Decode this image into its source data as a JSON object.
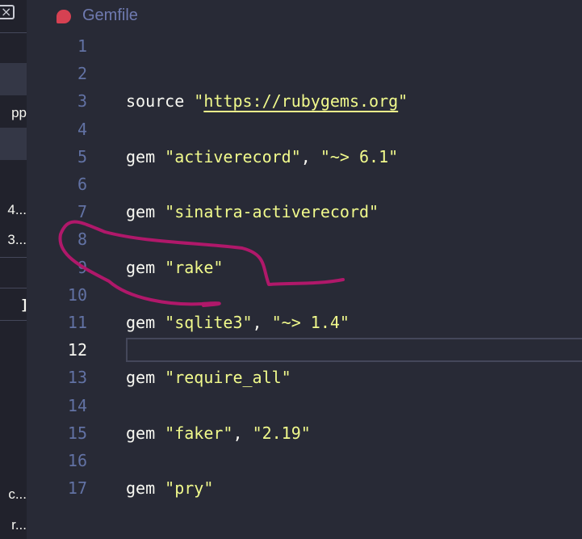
{
  "sidebar": {
    "fragments": [
      {
        "text": "pp"
      },
      {
        "text": "4..."
      },
      {
        "text": "3..."
      },
      {
        "text": "]"
      },
      {
        "text": "c..."
      },
      {
        "text": "r..."
      }
    ]
  },
  "tab": {
    "filename": "Gemfile",
    "icon": "ruby-gem-icon"
  },
  "editor": {
    "active_line": 12,
    "lines": [
      {
        "number": "1",
        "tokens": []
      },
      {
        "number": "2",
        "tokens": []
      },
      {
        "number": "3",
        "tokens": [
          {
            "text": "source ",
            "type": "kw"
          },
          {
            "text": "\"",
            "type": "str"
          },
          {
            "text": "https://rubygems.org",
            "type": "url"
          },
          {
            "text": "\"",
            "type": "str"
          }
        ]
      },
      {
        "number": "4",
        "tokens": []
      },
      {
        "number": "5",
        "tokens": [
          {
            "text": "gem ",
            "type": "kw"
          },
          {
            "text": "\"activerecord\"",
            "type": "str"
          },
          {
            "text": ", ",
            "type": "punct"
          },
          {
            "text": "\"~> 6.1\"",
            "type": "str"
          }
        ]
      },
      {
        "number": "6",
        "tokens": []
      },
      {
        "number": "7",
        "tokens": [
          {
            "text": "gem ",
            "type": "kw"
          },
          {
            "text": "\"sinatra-activerecord\"",
            "type": "str"
          }
        ]
      },
      {
        "number": "8",
        "tokens": []
      },
      {
        "number": "9",
        "tokens": [
          {
            "text": "gem ",
            "type": "kw"
          },
          {
            "text": "\"rake\"",
            "type": "str"
          }
        ]
      },
      {
        "number": "10",
        "tokens": []
      },
      {
        "number": "11",
        "tokens": [
          {
            "text": "gem ",
            "type": "kw"
          },
          {
            "text": "\"sqlite3\"",
            "type": "str"
          },
          {
            "text": ", ",
            "type": "punct"
          },
          {
            "text": "\"~> 1.4\"",
            "type": "str"
          }
        ]
      },
      {
        "number": "12",
        "tokens": []
      },
      {
        "number": "13",
        "tokens": [
          {
            "text": "gem ",
            "type": "kw"
          },
          {
            "text": "\"require_all\"",
            "type": "str"
          }
        ]
      },
      {
        "number": "14",
        "tokens": []
      },
      {
        "number": "15",
        "tokens": [
          {
            "text": "gem ",
            "type": "kw"
          },
          {
            "text": "\"faker\"",
            "type": "str"
          },
          {
            "text": ", ",
            "type": "punct"
          },
          {
            "text": "\"2.19\"",
            "type": "str"
          }
        ]
      },
      {
        "number": "16",
        "tokens": []
      },
      {
        "number": "17",
        "tokens": [
          {
            "text": "gem ",
            "type": "kw"
          },
          {
            "text": "\"pry\"",
            "type": "str"
          }
        ]
      }
    ]
  },
  "colors": {
    "background": "#282a36",
    "line_number": "#6272a4",
    "string": "#f1fa8c",
    "text": "#f8f8f2",
    "annotation": "#b0186a"
  }
}
